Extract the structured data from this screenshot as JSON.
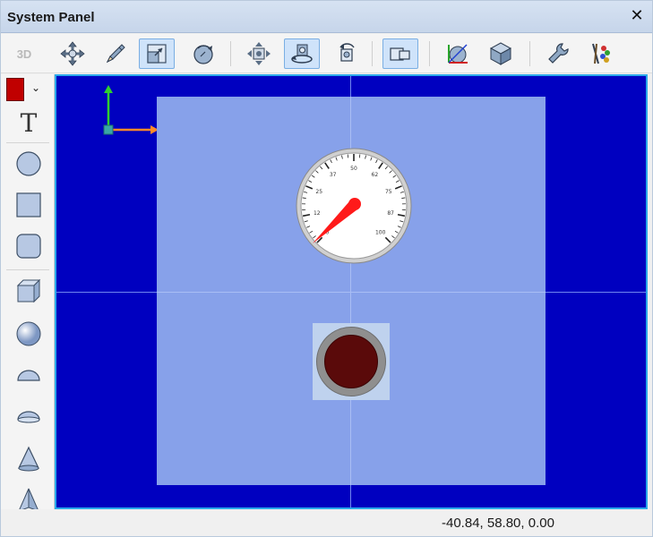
{
  "window": {
    "title": "System Panel",
    "close_glyph": "✕"
  },
  "toolbar": {
    "mode_label": "3D",
    "buttons": [
      {
        "icon": "move-icon"
      },
      {
        "icon": "pencil-icon"
      },
      {
        "icon": "resize-icon",
        "active": true
      },
      {
        "icon": "rotate-icon"
      },
      {
        "icon": "pan-icon"
      },
      {
        "icon": "orbit-icon",
        "active": true
      },
      {
        "icon": "rotate-view-icon"
      },
      {
        "icon": "frame-icon",
        "active": true
      },
      {
        "icon": "axes-box-icon"
      },
      {
        "icon": "cube-icon"
      },
      {
        "icon": "wrench-icon"
      },
      {
        "icon": "paint-tools-icon"
      }
    ]
  },
  "palette": {
    "color": "#c00000",
    "text_tool": "T",
    "items": [
      "circle-icon",
      "square-icon",
      "rounded-square-icon",
      "box-3d-icon",
      "sphere-icon",
      "half-sphere-icon",
      "dome-icon",
      "cone-icon",
      "pyramid-icon"
    ]
  },
  "canvas": {
    "background": "#0000c0",
    "stage_color": "#87a1ea",
    "gauge": {
      "scale_labels": [
        "0",
        "12",
        "25",
        "37",
        "50",
        "62",
        "75",
        "87",
        "100"
      ]
    },
    "lamp_color": "#5a0a0a"
  },
  "status": {
    "coords": "-40.84, 58.80, 0.00"
  }
}
